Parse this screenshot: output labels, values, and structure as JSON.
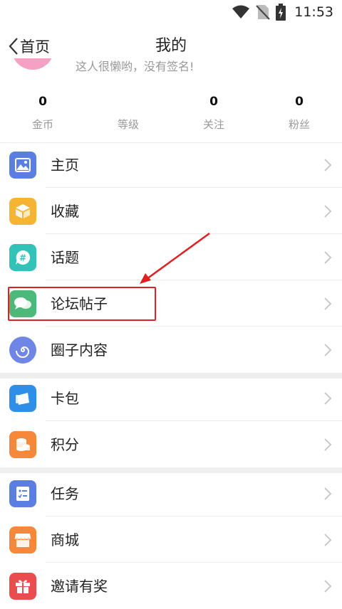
{
  "status_bar": {
    "time": "11:53",
    "icons": [
      "wifi-icon",
      "no-sim-icon",
      "battery-charging-icon"
    ]
  },
  "header": {
    "back_label": "首页",
    "title": "我的"
  },
  "profile": {
    "signature": "这人很懒哟，没有签名!"
  },
  "stats": [
    {
      "value": "0",
      "label": "金币"
    },
    {
      "value": "",
      "label": "等级"
    },
    {
      "value": "0",
      "label": "关注"
    },
    {
      "value": "0",
      "label": "粉丝"
    }
  ],
  "menu": {
    "group1": [
      {
        "label": "主页",
        "icon": "image-icon",
        "color": "#5b7fe0"
      },
      {
        "label": "收藏",
        "icon": "box-icon",
        "color": "#f5b432"
      },
      {
        "label": "话题",
        "icon": "hashtag-bubble-icon",
        "color": "#33c2b8"
      },
      {
        "label": "论坛帖子",
        "icon": "chat-bubbles-icon",
        "color": "#4cb87a"
      },
      {
        "label": "圈子内容",
        "icon": "spiral-icon",
        "color": "#6f86e6"
      }
    ],
    "group2": [
      {
        "label": "卡包",
        "icon": "card-icon",
        "color": "#2f8fe8"
      },
      {
        "label": "积分",
        "icon": "coins-icon",
        "color": "#f5883a"
      }
    ],
    "group3": [
      {
        "label": "任务",
        "icon": "checklist-icon",
        "color": "#5b7fe0"
      },
      {
        "label": "商城",
        "icon": "store-icon",
        "color": "#f5883a"
      },
      {
        "label": "邀请有奖",
        "icon": "gift-icon",
        "color": "#ea4d4d"
      }
    ]
  },
  "annotation": {
    "highlight_color": "#e02020"
  }
}
